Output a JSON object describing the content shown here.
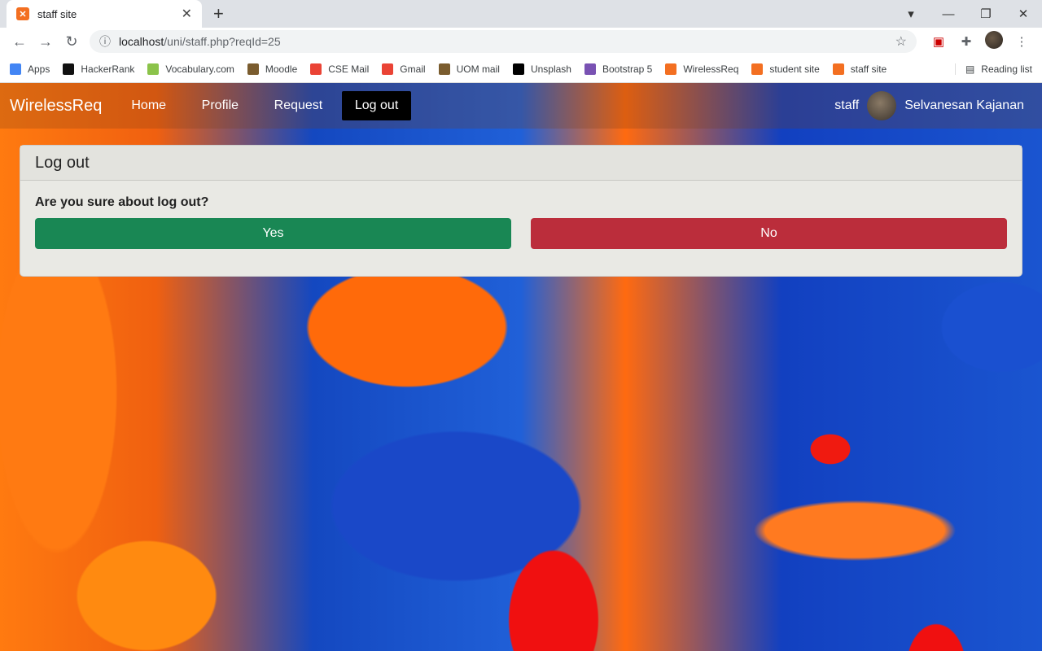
{
  "browser": {
    "tab_title": "staff site",
    "url_host": "localhost",
    "url_path": "/uni/staff.php?reqId=25",
    "bookmarks": [
      {
        "label": "Apps",
        "color": "#4285f4"
      },
      {
        "label": "HackerRank",
        "color": "#111111"
      },
      {
        "label": "Vocabulary.com",
        "color": "#8bc34a"
      },
      {
        "label": "Moodle",
        "color": "#7a5c2e"
      },
      {
        "label": "CSE Mail",
        "color": "#ea4335"
      },
      {
        "label": "Gmail",
        "color": "#ea4335"
      },
      {
        "label": "UOM mail",
        "color": "#7a5c2e"
      },
      {
        "label": "Unsplash",
        "color": "#000000"
      },
      {
        "label": "Bootstrap 5",
        "color": "#7952b3"
      },
      {
        "label": "WirelessReq",
        "color": "#f36f21"
      },
      {
        "label": "student site",
        "color": "#f36f21"
      },
      {
        "label": "staff site",
        "color": "#f36f21"
      }
    ],
    "reading_list": "Reading list"
  },
  "navbar": {
    "brand": "WirelessReq",
    "links": [
      "Home",
      "Profile",
      "Request",
      "Log out"
    ],
    "role": "staff",
    "user_name": "Selvanesan Kajanan"
  },
  "card": {
    "title": "Log out",
    "question": "Are you sure about log out?",
    "yes": "Yes",
    "no": "No"
  },
  "colors": {
    "yes": "#198754",
    "no": "#bb2d3b",
    "active_nav": "#000000"
  }
}
